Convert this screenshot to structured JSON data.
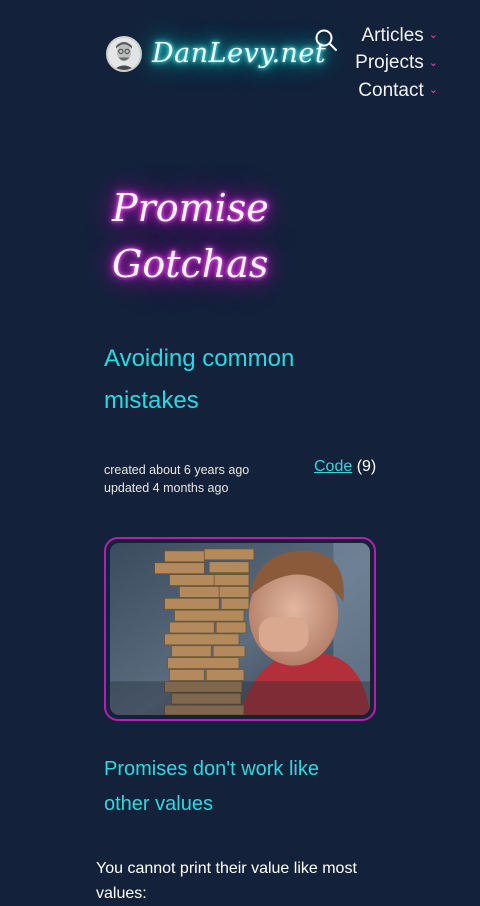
{
  "header": {
    "site_title": "DanLevy.net",
    "nav": [
      {
        "label": "Articles"
      },
      {
        "label": "Projects"
      },
      {
        "label": "Contact"
      }
    ]
  },
  "article": {
    "title_line1": "Promise",
    "title_line2": "Gotchas",
    "subtitle": "Avoiding common mistakes",
    "created": "created about 6 years ago",
    "updated": "updated 4 months ago",
    "tag_label": "Code",
    "tag_count": "(9)",
    "section_heading": "Promises don't work like other values",
    "body": "You cannot print their value like most values:"
  },
  "colors": {
    "background": "#13223a",
    "accent_cyan": "#2fd8df",
    "accent_magenta": "#b51fb0",
    "chevron": "#ff3fb5"
  },
  "icons": [
    "avatar",
    "search-icon",
    "chevron-down-icon"
  ]
}
